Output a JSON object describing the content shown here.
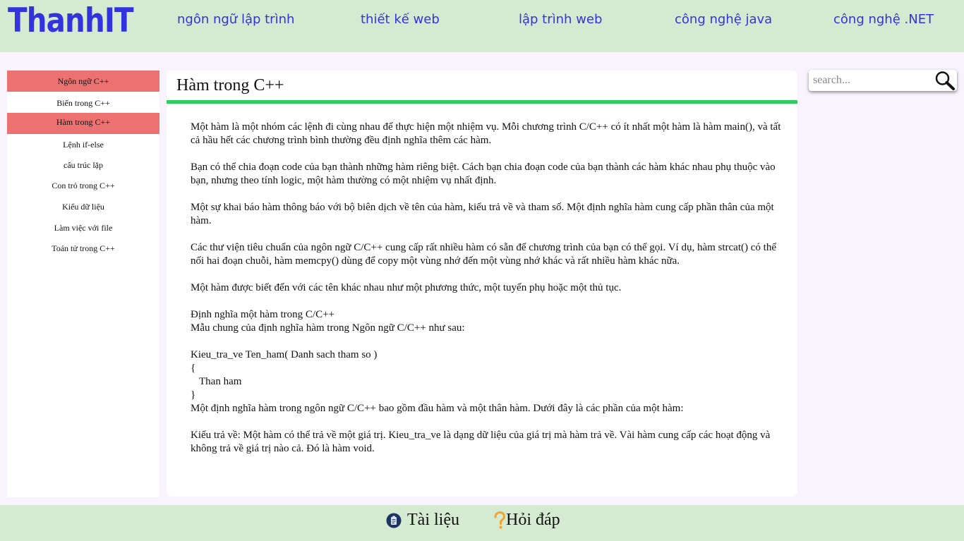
{
  "header": {
    "logo": "ThanhIT",
    "nav": [
      {
        "label": "ngôn ngữ lập trình"
      },
      {
        "label": "thiết kế web"
      },
      {
        "label": "lập trình web"
      },
      {
        "label": "công nghệ java"
      },
      {
        "label": "công nghệ .NET"
      }
    ]
  },
  "sidebar": {
    "items": [
      {
        "label": "Ngôn ngữ C++",
        "active": true
      },
      {
        "label": "Biến trong C++",
        "active": false
      },
      {
        "label": "Hàm trong C++",
        "active": true
      },
      {
        "label": "Lệnh if-else",
        "active": false
      },
      {
        "label": "cấu trúc lặp",
        "active": false
      },
      {
        "label": "Con trỏ trong C++",
        "active": false
      },
      {
        "label": "Kiểu dữ liệu",
        "active": false
      },
      {
        "label": "Làm việc với file",
        "active": false
      },
      {
        "label": "Toán tử trong C++",
        "active": false
      }
    ]
  },
  "main": {
    "title": "Hàm trong C++",
    "paragraphs": [
      "Một hàm là một nhóm các lệnh đi cùng nhau để thực hiện một nhiệm vụ. Mỗi chương trình C/C++ có ít nhất một hàm là hàm main(), và tất cả hầu hết các chương trình bình thường đều định nghĩa thêm các hàm.",
      "Bạn có thể chia đoạn code của bạn thành những hàm riêng biệt. Cách bạn chia đoạn code của bạn thành các hàm khác nhau phụ thuộc vào bạn, nhưng theo tính logic, một hàm thường có một nhiệm vụ nhất định.",
      "Một sự khai báo hàm thông báo với bộ biên dịch về tên của hàm, kiểu trả về và tham số. Một định nghĩa hàm cung cấp phần thân của một hàm.",
      "Các thư viện tiêu chuẩn của ngôn ngữ C/C++ cung cấp rất nhiều hàm có sẵn để chương trình của bạn có thể gọi. Ví dụ, hàm strcat() có thể nối hai đoạn chuỗi, hàm memcpy() dùng để copy một vùng nhớ đến một vùng nhớ khác và rất nhiều hàm khác nữa.",
      "Một hàm được biết đến với các tên khác nhau như một phương thức, một tuyến phụ hoặc một thủ tục."
    ],
    "definition_heading": "Định nghĩa một hàm trong C/C++",
    "definition_intro": "Mẫu chung của định nghĩa hàm trong Ngôn ngữ C/C++ như sau:",
    "code": {
      "signature": "Kieu_tra_ve Ten_ham( Danh sach tham so )",
      "open_brace": "{",
      "body": "Than ham",
      "close_brace": "}"
    },
    "after_code": "Một định nghĩa hàm trong ngôn ngữ C/C++ bao gồm đầu hàm và một thân hàm. Dưới đây là các phần của một hàm:",
    "return_type_paragraph": "Kiểu trả về: Một hàm có thể trả về một giá trị. Kieu_tra_ve là dạng dữ liệu của giá trị mà hàm trả về. Vài hàm cung cấp các hoạt động và không trả về giá trị nào cả. Đó là hàm void."
  },
  "search": {
    "placeholder": "search...",
    "icon": "magnifier-icon"
  },
  "footer": {
    "docs_label": "Tài liệu",
    "docs_icon": "clipboard-icon",
    "qa_label": "Hỏi đáp",
    "qa_icon": "question-mark-icon"
  },
  "colors": {
    "header_bg": "#d5ebd1",
    "accent_blue": "#3333dd",
    "active_item": "#ec7272",
    "title_bar": "#2ecc5e"
  }
}
